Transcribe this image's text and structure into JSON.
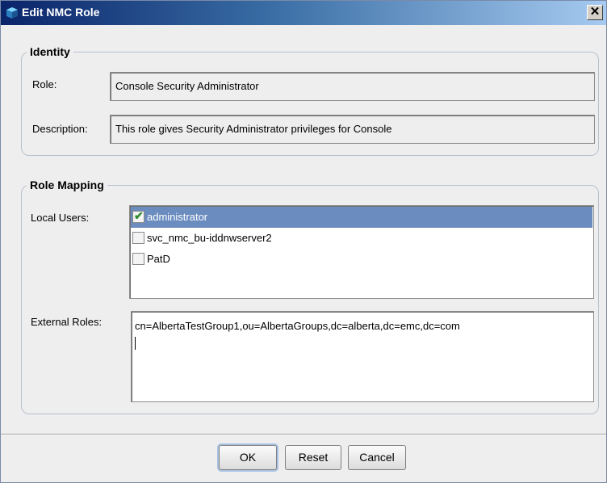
{
  "window": {
    "title": "Edit NMC Role",
    "close_label": "✕"
  },
  "identity": {
    "legend": "Identity",
    "role_label": "Role:",
    "role_value": "Console Security Administrator",
    "description_label": "Description:",
    "description_value": "This role gives Security Administrator privileges for Console"
  },
  "role_mapping": {
    "legend": "Role Mapping",
    "local_users_label": "Local Users:",
    "local_users": [
      {
        "name": "administrator",
        "checked": true,
        "selected": true
      },
      {
        "name": "svc_nmc_bu-iddnwserver2",
        "checked": false,
        "selected": false
      },
      {
        "name": "PatD",
        "checked": false,
        "selected": false
      }
    ],
    "external_roles_label": "External Roles:",
    "external_roles_value": "cn=AlbertaTestGroup1,ou=AlbertaGroups,dc=alberta,dc=emc,dc=com"
  },
  "buttons": {
    "ok": "OK",
    "reset": "Reset",
    "cancel": "Cancel"
  },
  "colors": {
    "selection": "#6b8cbf",
    "checkmark": "#2e8b2e",
    "titlebar": "#0a246a"
  }
}
